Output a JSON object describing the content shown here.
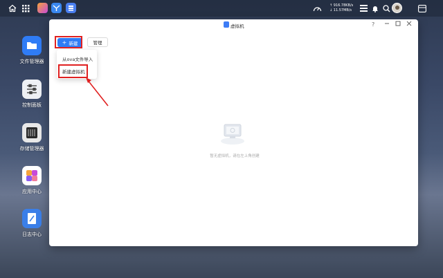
{
  "taskbar": {
    "net_up": "↑ 916.78KB/s",
    "net_down": "↓ 11.57MB/s"
  },
  "desktop": {
    "items": [
      {
        "label": "文件管理器"
      },
      {
        "label": "控制面板"
      },
      {
        "label": "存储管理器"
      },
      {
        "label": "应用中心"
      },
      {
        "label": "日志中心"
      }
    ]
  },
  "window": {
    "title": "虚拟机",
    "help": "?",
    "toolbar": {
      "new_label": "新建",
      "manage_label": "管理"
    },
    "menu": {
      "items": [
        {
          "label": "从ova文件导入"
        },
        {
          "label": "新建虚拟机"
        }
      ]
    },
    "empty_text": "暂无虚拟机，请在左上角创建"
  },
  "colors": {
    "accent": "#2f7cf6",
    "highlight": "#e02020"
  }
}
